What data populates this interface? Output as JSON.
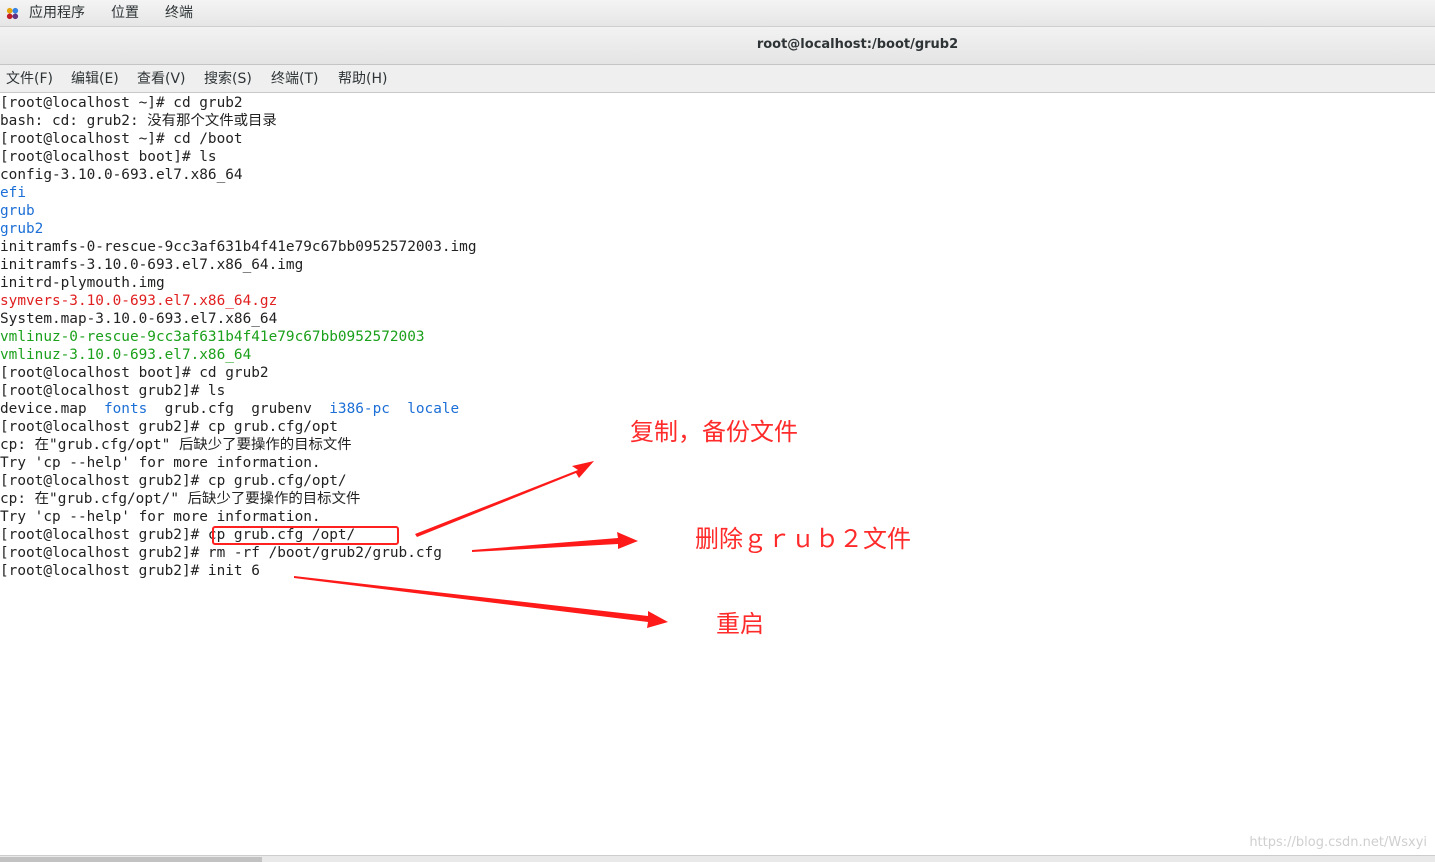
{
  "topbar": {
    "apps_label": "应用程序",
    "places_label": "位置",
    "terminal_label": "终端"
  },
  "window": {
    "title": "root@localhost:/boot/grub2"
  },
  "menubar": {
    "file": "文件(F)",
    "edit": "编辑(E)",
    "view": "查看(V)",
    "search": "搜索(S)",
    "terminal": "终端(T)",
    "help": "帮助(H)"
  },
  "terminal": {
    "lines": [
      {
        "segments": [
          {
            "text": "[root@localhost ~]# cd grub2",
            "color": "default"
          }
        ]
      },
      {
        "segments": [
          {
            "text": "bash: cd: grub2: 没有那个文件或目录",
            "color": "default"
          }
        ]
      },
      {
        "segments": [
          {
            "text": "[root@localhost ~]# cd /boot",
            "color": "default"
          }
        ]
      },
      {
        "segments": [
          {
            "text": "[root@localhost boot]# ls",
            "color": "default"
          }
        ]
      },
      {
        "segments": [
          {
            "text": "config-3.10.0-693.el7.x86_64",
            "color": "default"
          }
        ]
      },
      {
        "segments": [
          {
            "text": "efi",
            "color": "blue"
          }
        ]
      },
      {
        "segments": [
          {
            "text": "grub",
            "color": "blue"
          }
        ]
      },
      {
        "segments": [
          {
            "text": "grub2",
            "color": "blue"
          }
        ]
      },
      {
        "segments": [
          {
            "text": "initramfs-0-rescue-9cc3af631b4f41e79c67bb0952572003.img",
            "color": "default"
          }
        ]
      },
      {
        "segments": [
          {
            "text": "initramfs-3.10.0-693.el7.x86_64.img",
            "color": "default"
          }
        ]
      },
      {
        "segments": [
          {
            "text": "initrd-plymouth.img",
            "color": "default"
          }
        ]
      },
      {
        "segments": [
          {
            "text": "symvers-3.10.0-693.el7.x86_64.gz",
            "color": "red"
          }
        ]
      },
      {
        "segments": [
          {
            "text": "System.map-3.10.0-693.el7.x86_64",
            "color": "default"
          }
        ]
      },
      {
        "segments": [
          {
            "text": "vmlinuz-0-rescue-9cc3af631b4f41e79c67bb0952572003",
            "color": "green"
          }
        ]
      },
      {
        "segments": [
          {
            "text": "vmlinuz-3.10.0-693.el7.x86_64",
            "color": "green"
          }
        ]
      },
      {
        "segments": [
          {
            "text": "[root@localhost boot]# cd grub2",
            "color": "default"
          }
        ]
      },
      {
        "segments": [
          {
            "text": "[root@localhost grub2]# ls",
            "color": "default"
          }
        ]
      },
      {
        "segments": [
          {
            "text": "device.map  ",
            "color": "default"
          },
          {
            "text": "fonts",
            "color": "blue"
          },
          {
            "text": "  grub.cfg  grubenv  ",
            "color": "default"
          },
          {
            "text": "i386-pc",
            "color": "blue"
          },
          {
            "text": "  ",
            "color": "default"
          },
          {
            "text": "locale",
            "color": "blue"
          }
        ]
      },
      {
        "segments": [
          {
            "text": "[root@localhost grub2]# cp grub.cfg/opt",
            "color": "default"
          }
        ]
      },
      {
        "segments": [
          {
            "text": "cp: 在\"grub.cfg/opt\" 后缺少了要操作的目标文件",
            "color": "default"
          }
        ]
      },
      {
        "segments": [
          {
            "text": "Try 'cp --help' for more information.",
            "color": "default"
          }
        ]
      },
      {
        "segments": [
          {
            "text": "[root@localhost grub2]# cp grub.cfg/opt/",
            "color": "default"
          }
        ]
      },
      {
        "segments": [
          {
            "text": "cp: 在\"grub.cfg/opt/\" 后缺少了要操作的目标文件",
            "color": "default"
          }
        ]
      },
      {
        "segments": [
          {
            "text": "Try 'cp --help' for more information.",
            "color": "default"
          }
        ]
      },
      {
        "segments": [
          {
            "text": "[root@localhost grub2]# cp grub.cfg /opt/",
            "color": "default"
          }
        ]
      },
      {
        "segments": [
          {
            "text": "[root@localhost grub2]# rm -rf /boot/grub2/grub.cfg",
            "color": "default"
          }
        ]
      },
      {
        "segments": [
          {
            "text": "[root@localhost grub2]# init 6",
            "color": "default"
          }
        ]
      }
    ]
  },
  "annotations": {
    "copy_backup": "复制，备份文件",
    "delete_grub2": "删除ｇｒｕｂ２文件",
    "restart": "重启"
  },
  "colors": {
    "blue": "#1c6fd6",
    "red": "#e02020",
    "green": "#1ba01b",
    "default": "#222222",
    "annotation": "#ff2a2a"
  },
  "watermark": "https://blog.csdn.net/Wsxyi"
}
